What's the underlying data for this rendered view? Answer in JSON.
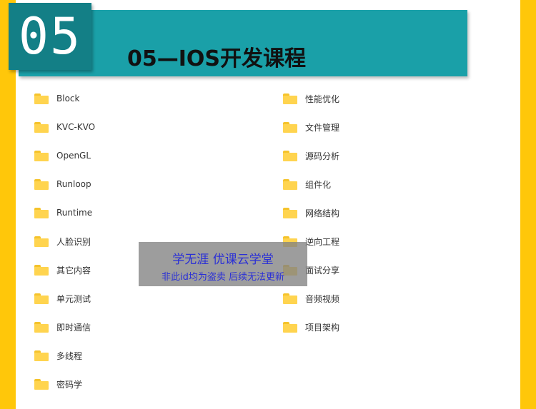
{
  "banner": {
    "number": "05",
    "title": "05—IOS开发课程"
  },
  "folders_left": [
    {
      "label": "Block"
    },
    {
      "label": "KVC-KVO"
    },
    {
      "label": "OpenGL"
    },
    {
      "label": "Runloop"
    },
    {
      "label": "Runtime"
    },
    {
      "label": "人脸识别"
    },
    {
      "label": "其它内容"
    },
    {
      "label": "单元测试"
    },
    {
      "label": "即时通信"
    },
    {
      "label": "多线程"
    },
    {
      "label": "密码学"
    }
  ],
  "folders_right": [
    {
      "label": "性能优化"
    },
    {
      "label": "文件管理"
    },
    {
      "label": "源码分析"
    },
    {
      "label": "组件化"
    },
    {
      "label": "网络结构"
    },
    {
      "label": "逆向工程"
    },
    {
      "label": "面试分享"
    },
    {
      "label": "音频视频"
    },
    {
      "label": "项目架构"
    }
  ],
  "watermark": {
    "line1": "学无涯  优课云学堂",
    "line2": "非此id均为盗卖 后续无法更新"
  },
  "colors": {
    "side_bar": "#ffc70a",
    "banner": "#1aa0a8",
    "number_box": "#137f86",
    "folder": "#ffd44f",
    "watermark_text": "#2a2fd6"
  }
}
